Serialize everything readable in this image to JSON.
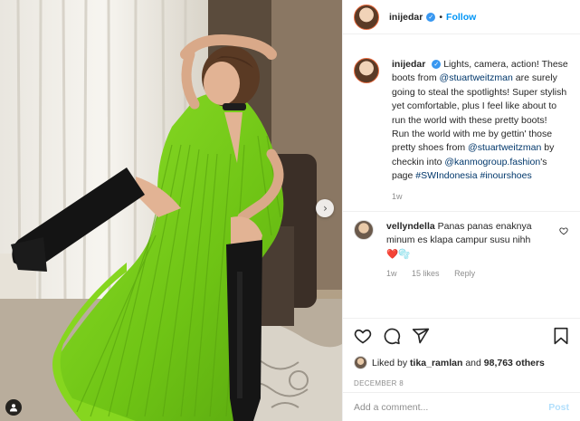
{
  "header": {
    "username": "inijedar",
    "separator": "•",
    "follow_label": "Follow"
  },
  "caption": {
    "username": "inijedar",
    "text_1": "Lights, camera, action! These boots from ",
    "mention_1": "@stuartweitzman",
    "text_2": " are surely going to steal the spotlights! Super stylish yet comfortable, plus I feel like about to run the world with these pretty boots!",
    "text_3": "Run the world with me by gettin' those pretty shoes from ",
    "mention_2": "@stuartweitzman",
    "text_4": " by checkin into ",
    "mention_3": "@kanmogroup.fashion",
    "text_5": "'s page ",
    "hashtag_1": "#SWIndonesia",
    "hashtag_2": "#inourshoes",
    "time": "1w"
  },
  "comment": {
    "username": "vellyndella",
    "text": "Panas panas enaknya minum es klapa campur susu nihh",
    "emoji": "❤️🫧",
    "time": "1w",
    "likes": "15 likes",
    "reply_label": "Reply"
  },
  "likes": {
    "prefix": "Liked by ",
    "user": "tika_ramlan",
    "middle": " and ",
    "count": "98,763 others"
  },
  "date": "DECEMBER 8",
  "add_comment": {
    "placeholder": "Add a comment...",
    "post_label": "Post"
  },
  "colors": {
    "accent": "#0095f6",
    "mention": "#00376b",
    "dress": "#7ed321",
    "like_heart": "#ed4956"
  },
  "icons": [
    "heart-icon",
    "comment-icon",
    "share-icon",
    "bookmark-icon",
    "verified-icon",
    "chevron-right-icon",
    "user-tag-icon"
  ]
}
